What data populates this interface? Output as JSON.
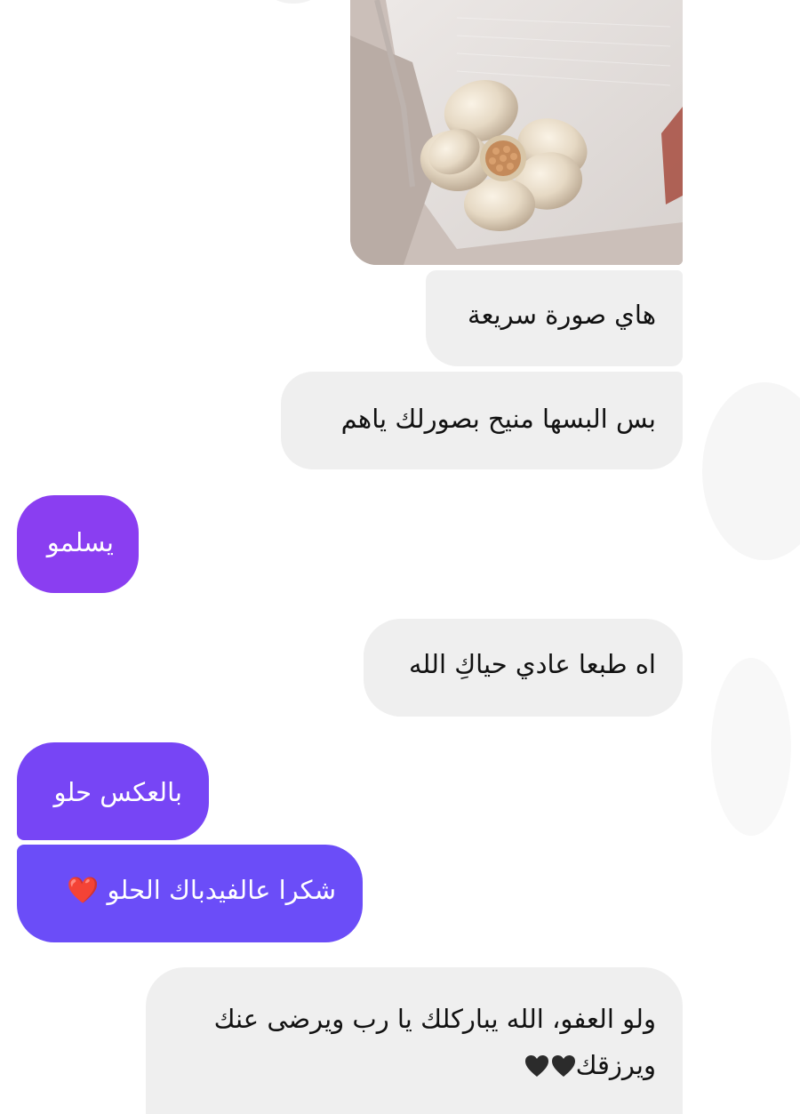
{
  "conversation": {
    "photo_icon": "flower-brooch-photo",
    "messages": [
      {
        "text": "هاي صورة سريعة",
        "side": "received"
      },
      {
        "text": "بس البسها منيح بصورلك ياهم",
        "side": "received"
      },
      {
        "text": "يسلمو",
        "side": "sent"
      },
      {
        "text": "اه طبعا عادي حياكِ الله",
        "side": "received"
      },
      {
        "text": "بالعكس حلو",
        "side": "sent"
      },
      {
        "text": "شكرا عالفيدباك الحلو ❤️",
        "side": "sent"
      },
      {
        "line1": "ولو العفو، الله يباركلك يا رب ويرضى عنك",
        "line2": "ويرزقك",
        "side": "received",
        "trailing_icons": [
          "black-heart-icon",
          "black-heart-icon"
        ]
      }
    ]
  },
  "colors": {
    "received_bubble": "#efefef",
    "sent_bubble_top": "#8a3df0",
    "sent_bubble_bottom": "#6a4cf8"
  }
}
